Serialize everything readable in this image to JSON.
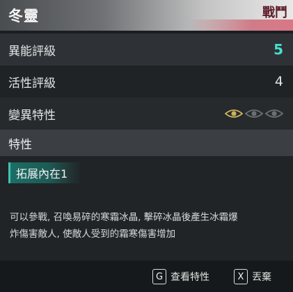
{
  "header": {
    "title": "冬靈",
    "type": "戰鬥"
  },
  "stats": [
    {
      "label": "異能評級",
      "value": "5"
    },
    {
      "label": "活性評級",
      "value": "4"
    },
    {
      "label": "變異特性"
    }
  ],
  "mutation_eyes": [
    {
      "name": "eye-icon-1",
      "active": true
    },
    {
      "name": "eye-icon-2",
      "active": false
    },
    {
      "name": "eye-icon-3",
      "active": false
    }
  ],
  "traits": {
    "heading": "特性",
    "chip": "拓展內在1",
    "description_line1": "可以參戰, 召喚易碎的寒霜冰晶, 擊碎冰晶後產生冰霜爆",
    "description_line2": "炸傷害敵人, 使敵人受到的霜寒傷害增加"
  },
  "footer": {
    "hint_view": {
      "key": "G",
      "label": "查看特性"
    },
    "hint_discard": {
      "key": "X",
      "label": "丟棄"
    }
  },
  "colors": {
    "accent": "#47e0cf",
    "eye_active": "#c8b25a",
    "eye_inactive": "#6a6f73"
  }
}
